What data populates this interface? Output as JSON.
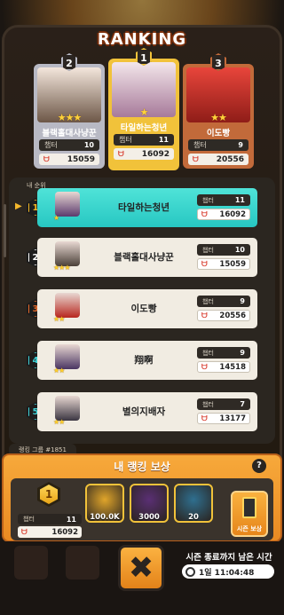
{
  "header": {
    "title": "RANKING"
  },
  "podium": [
    {
      "rank": "2",
      "name": "블랙홀대사냥꾼",
      "level_label": "챕터",
      "level": "10",
      "power": "15059",
      "stars": "★★★",
      "art_colors": [
        "#f3e6dc",
        "#6d5747"
      ],
      "frame_color": "#b8b9c4"
    },
    {
      "rank": "1",
      "name": "타일하는청년",
      "level_label": "챕터",
      "level": "11",
      "power": "16092",
      "stars": "★",
      "art_colors": [
        "#f3e6ea",
        "#a77a9a"
      ],
      "frame_color": "#f1c23a"
    },
    {
      "rank": "3",
      "name": "이도빵",
      "level_label": "챕터",
      "level": "9",
      "power": "20556",
      "stars": "★★",
      "art_colors": [
        "#e8453b",
        "#8f1d18"
      ],
      "frame_color": "#c26a3a"
    }
  ],
  "list": {
    "my_rank_label": "내 순위",
    "rows": [
      {
        "rank": "1",
        "name": "타일하는청년",
        "level_label": "챕터",
        "level": "11",
        "power": "16092",
        "stars": "★",
        "badge_color": "#f0b524",
        "avatar": "#5b3a6e",
        "mine": true
      },
      {
        "rank": "2",
        "name": "블랙홀대사냥꾼",
        "level_label": "챕터",
        "level": "10",
        "power": "15059",
        "stars": "★★★",
        "badge_color": "#ffffff",
        "avatar": "#4a4038",
        "mine": false
      },
      {
        "rank": "3",
        "name": "이도빵",
        "level_label": "챕터",
        "level": "9",
        "power": "20556",
        "stars": "★★",
        "badge_color": "#e86a2a",
        "avatar": "#b8261e",
        "mine": false
      },
      {
        "rank": "4",
        "name": "翔啊",
        "level_label": "챕터",
        "level": "9",
        "power": "14518",
        "stars": "★★",
        "badge_color": "#3fd3d8",
        "avatar": "#4a3562",
        "mine": false
      },
      {
        "rank": "5",
        "name": "별의지배자",
        "level_label": "챕터",
        "level": "7",
        "power": "13177",
        "stars": "★★",
        "badge_color": "#3fd3d8",
        "avatar": "#3b3642",
        "mine": false
      }
    ]
  },
  "reward": {
    "group_label": "랭킹 그룹 #1851",
    "title": "내 랭킹 보상",
    "help": "?",
    "my_rank": "1",
    "level_label": "챕터",
    "level": "11",
    "power": "16092",
    "items": [
      {
        "name": "gold-coin",
        "count": "100.0K",
        "bg": "#e0a52a"
      },
      {
        "name": "gem",
        "count": "3000",
        "bg": "#5a2f74"
      },
      {
        "name": "mystery-box",
        "count": "20",
        "bg": "#2f6f8f"
      }
    ],
    "season_button_label": "시즌 보상"
  },
  "footer": {
    "close_symbol": "✖",
    "season_remaining_label": "시즌 종료까지 남은 시간",
    "timer": "1일 11:04:48"
  },
  "power_icon_text": "ᗨ"
}
